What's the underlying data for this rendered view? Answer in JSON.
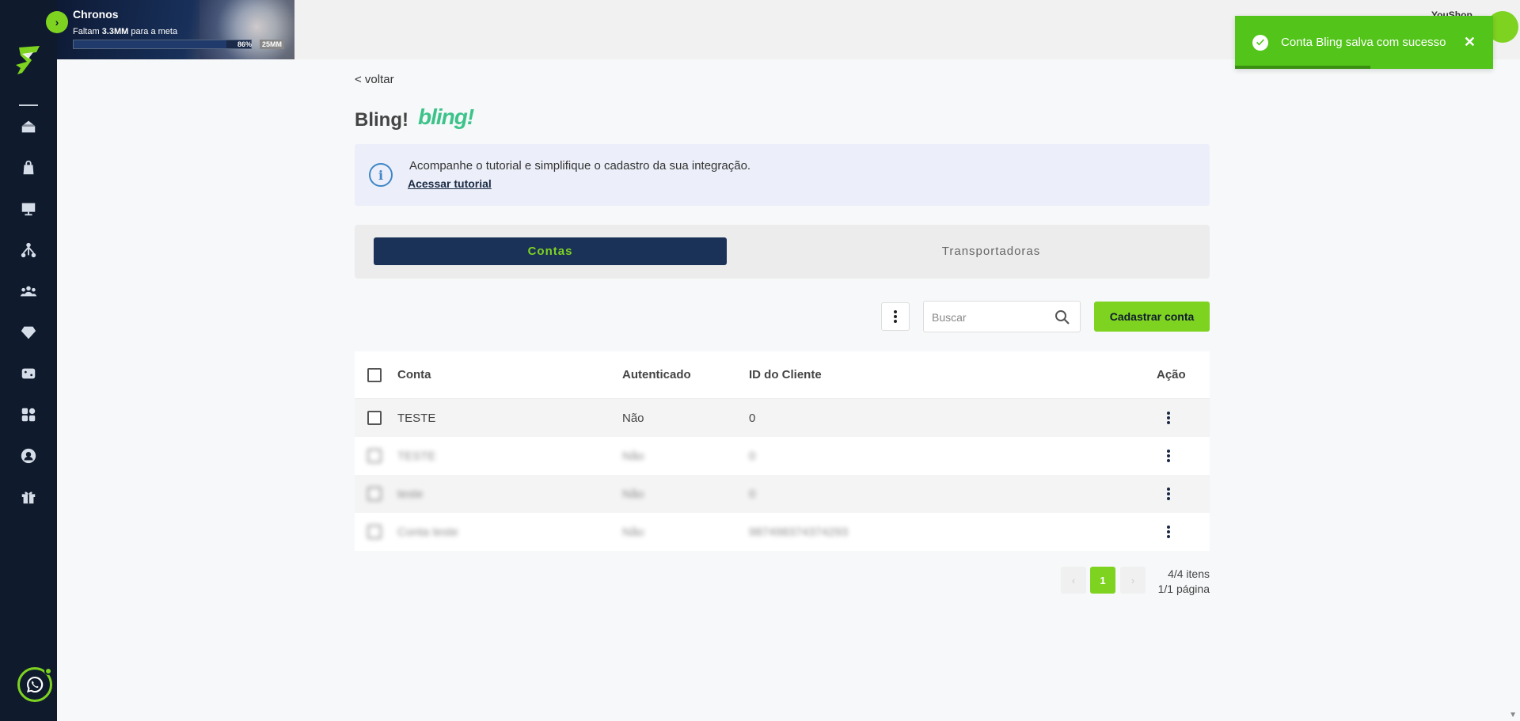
{
  "banner": {
    "title": "Chronos",
    "subtitle_prefix": "Faltam",
    "subtitle_amount": "3.3MM",
    "subtitle_suffix": "para a meta",
    "progress_label": "86%",
    "progress": 0.86,
    "goal_label": "25MM"
  },
  "user": {
    "name": "YouShop"
  },
  "toast": {
    "message": "Conta Bling salva com sucesso",
    "close": "✕",
    "color": "#52c41a"
  },
  "nav": {
    "back": "< voltar",
    "title": "Bling!",
    "logo_text": "bling!"
  },
  "info": {
    "text": "Acompanhe o tutorial e simplifique o cadastro da sua integração.",
    "link": "Acessar tutorial"
  },
  "tabs": [
    {
      "label": "Contas",
      "active": true
    },
    {
      "label": "Transportadoras",
      "active": false
    }
  ],
  "search": {
    "placeholder": "Buscar"
  },
  "cta": {
    "label": "Cadastrar conta"
  },
  "table": {
    "headers": {
      "conta": "Conta",
      "autenticado": "Autenticado",
      "id": "ID do Cliente",
      "acao": "Ação"
    },
    "rows": [
      {
        "conta": "TESTE",
        "autenticado": "Não",
        "id": "0"
      },
      {
        "conta": "TESTE",
        "autenticado": "Não",
        "id": "0"
      },
      {
        "conta": "teste",
        "autenticado": "Não",
        "id": "0"
      },
      {
        "conta": "Conta teste",
        "autenticado": "Não",
        "id": "987498374374293"
      }
    ]
  },
  "pagination": {
    "current": "1",
    "prev": "‹",
    "next": "›",
    "items": "4/4 itens",
    "pages": "1/1 página"
  },
  "colors": {
    "accent": "#7ed321",
    "sidebar": "#0f1b2d",
    "tab_active": "#1a3257"
  }
}
